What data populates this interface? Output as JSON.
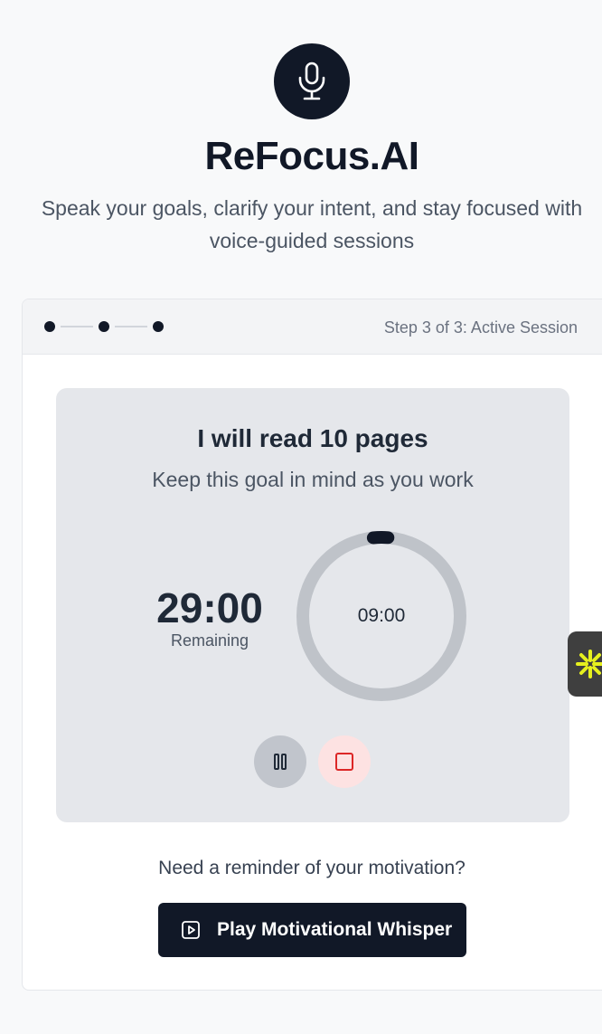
{
  "header": {
    "logo_icon": "microphone-icon",
    "title": "ReFocus.AI",
    "subtitle": "Speak your goals, clarify your intent, and stay focused with voice-guided sessions"
  },
  "stepper": {
    "total_steps": 3,
    "current_step": 3,
    "label": "Step 3 of 3: Active Session"
  },
  "session": {
    "goal": "I will read 10 pages",
    "hint": "Keep this goal in mind as you work",
    "remaining_time": "29:00",
    "remaining_caption": "Remaining",
    "ring_time": "09:00",
    "ring_progress_fraction": 0.03,
    "pause_icon": "pause-icon",
    "stop_icon": "stop-icon"
  },
  "motivation": {
    "prompt": "Need a reminder of your motivation?",
    "button_label": "Play Motivational Whisper",
    "button_icon": "play-icon"
  },
  "side_widget": {
    "icon": "sparkle-icon",
    "color": "#e6f01e"
  },
  "colors": {
    "primary": "#111827",
    "panel": "#e5e7eb",
    "stop_red": "#dc2626",
    "stop_bg": "#fde2e2"
  }
}
